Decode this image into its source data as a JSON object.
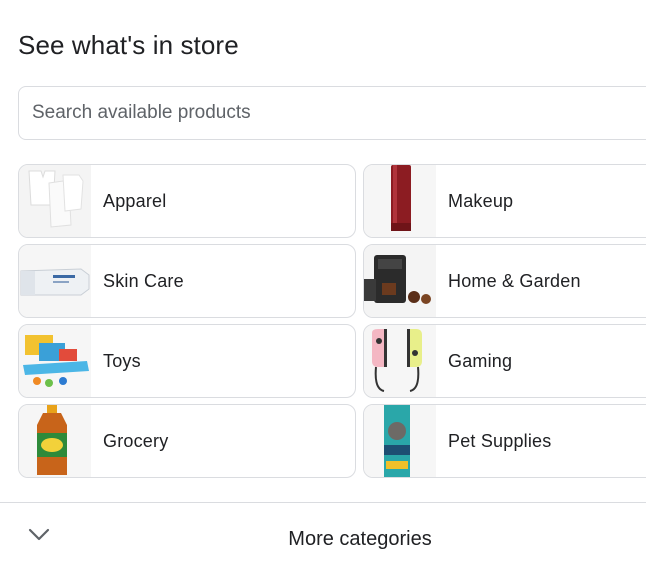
{
  "section": {
    "title": "See what's in store"
  },
  "search": {
    "placeholder": "Search available products"
  },
  "categories": [
    {
      "label": "Apparel",
      "icon": "apparel-icon"
    },
    {
      "label": "Makeup",
      "icon": "makeup-icon"
    },
    {
      "label": "Skin Care",
      "icon": "skin-care-icon"
    },
    {
      "label": "Home & Garden",
      "icon": "home-garden-icon"
    },
    {
      "label": "Toys",
      "icon": "toys-icon"
    },
    {
      "label": "Gaming",
      "icon": "gaming-icon"
    },
    {
      "label": "Grocery",
      "icon": "grocery-icon"
    },
    {
      "label": "Pet Supplies",
      "icon": "pet-supplies-icon"
    }
  ],
  "more": {
    "label": "More categories",
    "icon": "chevron-down-icon"
  }
}
